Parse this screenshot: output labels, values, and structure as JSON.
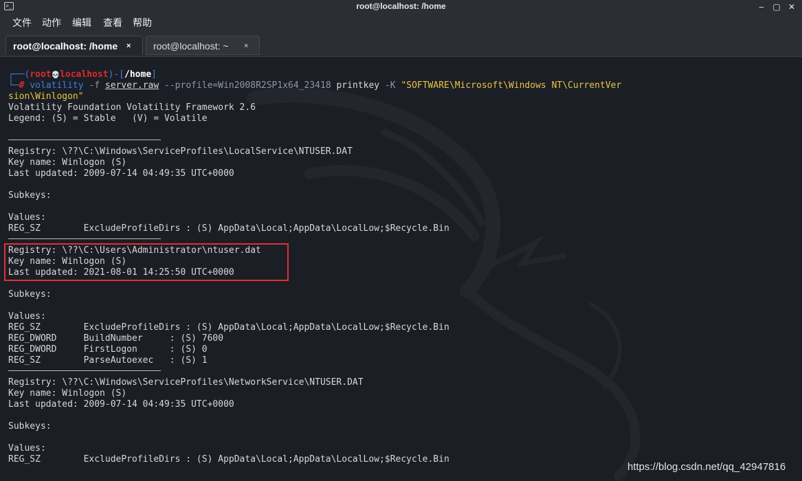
{
  "window": {
    "title": "root@localhost: /home",
    "minimize_glyph": "‒",
    "maximize_glyph": "▢",
    "close_glyph": "✕"
  },
  "menu": {
    "items": [
      "文件",
      "动作",
      "编辑",
      "查看",
      "帮助"
    ]
  },
  "tabs": [
    {
      "label": "root@localhost: /home",
      "close": "×"
    },
    {
      "label": "root@localhost: ~",
      "close": "×"
    }
  ],
  "prompt": {
    "open": "┌──(",
    "user": "root",
    "skull": "💀",
    "host": "localhost",
    "mid": ")-[",
    "path": "/home",
    "close": "]",
    "corner": "└─",
    "hash": "#",
    "cmd": "volatility",
    "flag_f": "-f",
    "file": "server.raw",
    "profile": "--profile=Win2008R2SP1x64_23418",
    "plugin": "printkey",
    "flag_k": "-K",
    "key_part1": "\"SOFTWARE\\Microsoft\\Windows NT\\CurrentVer",
    "key_part2": "sion\\Winlogon\""
  },
  "output": {
    "banner": "Volatility Foundation Volatility Framework 2.6",
    "legend": "Legend: (S) = Stable   (V) = Volatile",
    "block1": {
      "registry": "Registry: \\??\\C:\\Windows\\ServiceProfiles\\LocalService\\NTUSER.DAT",
      "keyname": "Key name: Winlogon (S)",
      "updated": "Last updated: 2009-07-14 04:49:35 UTC+0000",
      "subkeys": "Subkeys:",
      "values": "Values:",
      "v1": "REG_SZ        ExcludeProfileDirs : (S) AppData\\Local;AppData\\LocalLow;$Recycle.Bin"
    },
    "block2": {
      "registry": "Registry: \\??\\C:\\Users\\Administrator\\ntuser.dat",
      "keyname": "Key name: Winlogon (S)",
      "updated": "Last updated: 2021-08-01 14:25:50 UTC+0000",
      "subkeys": "Subkeys:",
      "values": "Values:",
      "v1": "REG_SZ        ExcludeProfileDirs : (S) AppData\\Local;AppData\\LocalLow;$Recycle.Bin",
      "v2": "REG_DWORD     BuildNumber     : (S) 7600",
      "v3": "REG_DWORD     FirstLogon      : (S) 0",
      "v4": "REG_SZ        ParseAutoexec   : (S) 1"
    },
    "block3": {
      "registry": "Registry: \\??\\C:\\Windows\\ServiceProfiles\\NetworkService\\NTUSER.DAT",
      "keyname": "Key name: Winlogon (S)",
      "updated": "Last updated: 2009-07-14 04:49:35 UTC+0000",
      "subkeys": "Subkeys:",
      "values": "Values:",
      "v1": "REG_SZ        ExcludeProfileDirs : (S) AppData\\Local;AppData\\LocalLow;$Recycle.Bin"
    }
  },
  "watermark": "https://blog.csdn.net/qq_42947816",
  "colors": {
    "background": "#1b1e25",
    "chrome": "#2b2e35",
    "prompt_blue": "#3d7de3",
    "prompt_red": "#e0282e",
    "string_yellow": "#e8c547",
    "arg_gray": "#8f98a6",
    "highlight_box": "#e03034"
  }
}
